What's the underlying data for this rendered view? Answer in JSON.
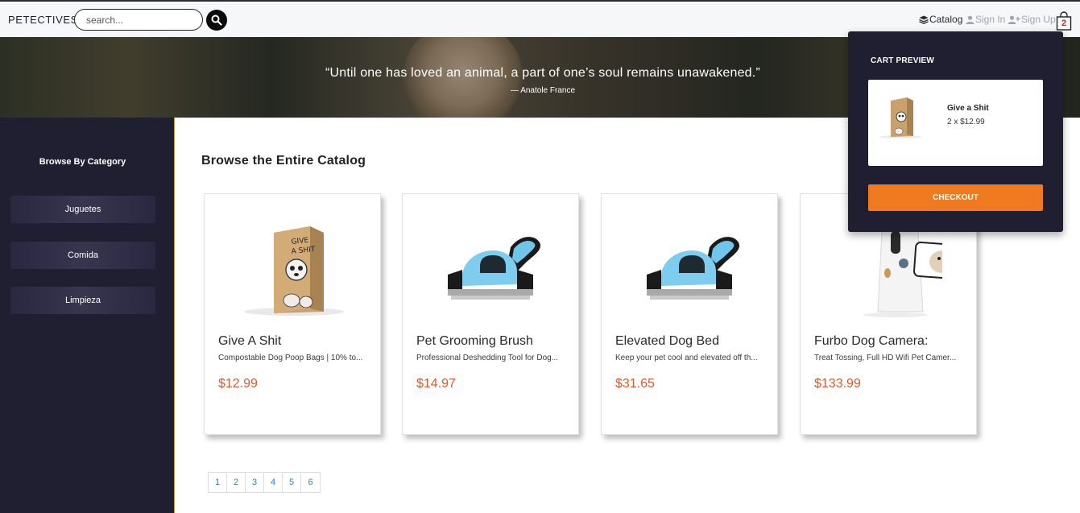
{
  "navbar": {
    "brand": "PETECTIVES",
    "search_placeholder": "search...",
    "catalog_label": "Catalog",
    "signin_label": "Sign In",
    "signup_label": "Sign Up",
    "cart_count": "2"
  },
  "hero": {
    "quote": "“Until one has loved an animal, a part of one’s soul remains unawakened.”",
    "author": "— Anatole France"
  },
  "sidebar": {
    "title": "Browse By Category",
    "categories": [
      {
        "label": "Juguetes"
      },
      {
        "label": "Comida"
      },
      {
        "label": "Limpieza"
      }
    ]
  },
  "main": {
    "title": "Browse the Entire Catalog",
    "products": [
      {
        "name": "Give A Shit",
        "description": "Compostable Dog Poop Bags | 10% to...",
        "price": "$12.99"
      },
      {
        "name": "Pet Grooming Brush",
        "description": "Professional Deshedding Tool for Dog...",
        "price": "$14.97"
      },
      {
        "name": "Elevated Dog Bed",
        "description": "Keep your pet cool and elevated off th...",
        "price": "$31.65"
      },
      {
        "name": "Furbo Dog Camera:",
        "description": "Treat Tossing, Full HD Wifi Pet Camer...",
        "price": "$133.99"
      }
    ],
    "pages": [
      "1",
      "2",
      "3",
      "4",
      "5",
      "6"
    ]
  },
  "cart_preview": {
    "title": "CART PREVIEW",
    "item_name": "Give a Shit",
    "item_qty": "2 x $12.99",
    "checkout_label": "CHECKOUT"
  },
  "colors": {
    "sidebar_bg": "#201e31",
    "price": "#e0582c",
    "checkout": "#f07a1f",
    "link": "#2a7bd5"
  }
}
